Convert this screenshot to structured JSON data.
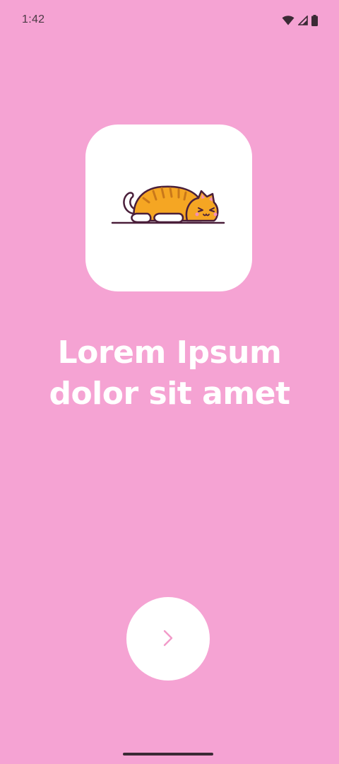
{
  "status_bar": {
    "time": "1:42",
    "icons": [
      "wifi-icon",
      "cellular-signal-icon",
      "battery-icon"
    ]
  },
  "logo": {
    "icon": "sleeping-cat-illustration"
  },
  "headline": {
    "line1": "Lorem Ipsum",
    "line2": "dolor sit amet"
  },
  "next_button": {
    "icon": "chevron-right-icon"
  },
  "colors": {
    "background": "#F5A3D3",
    "card": "#FFFFFF",
    "accent": "#F29AC9",
    "text": "#FFFFFF"
  }
}
